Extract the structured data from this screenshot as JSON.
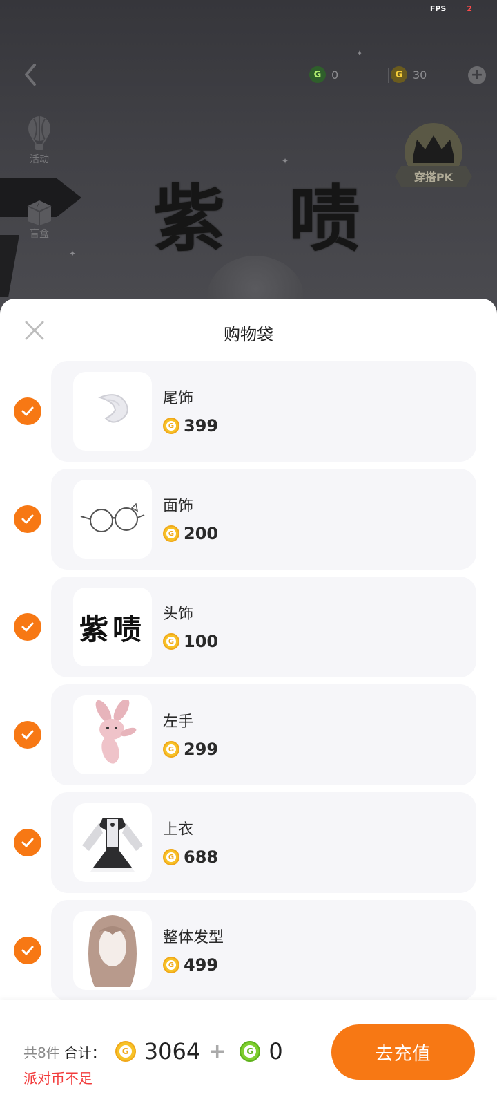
{
  "status": {
    "fps_label": "FPS",
    "fps_value": "2"
  },
  "hud": {
    "green_coin_amount": "0",
    "gold_coin_amount": "30",
    "activity_label": "活动",
    "blindbox_label": "盲盒",
    "pk_label": "穿搭PK",
    "banner_text": "紫 啧"
  },
  "sheet": {
    "title": "购物袋",
    "items": [
      {
        "name": "尾饰",
        "price": "399",
        "checked": true,
        "icon": "tail-accessory"
      },
      {
        "name": "面饰",
        "price": "200",
        "checked": true,
        "icon": "glasses"
      },
      {
        "name": "头饰",
        "price": "100",
        "checked": true,
        "icon": "text-headpiece",
        "thumb_text": "紫啧"
      },
      {
        "name": "左手",
        "price": "299",
        "checked": true,
        "icon": "bunny-plush"
      },
      {
        "name": "上衣",
        "price": "688",
        "checked": true,
        "icon": "dress-top"
      },
      {
        "name": "整体发型",
        "price": "499",
        "checked": true,
        "icon": "hairstyle"
      }
    ]
  },
  "footer": {
    "count_label": "共8件",
    "total_label": "合计：",
    "gold_total": "3064",
    "plus": "+",
    "green_total": "0",
    "warning": "派对币不足",
    "recharge_label": "去充值"
  },
  "colors": {
    "accent": "#f77814",
    "warning": "#f23c3c",
    "card_bg": "#f6f6f9"
  }
}
